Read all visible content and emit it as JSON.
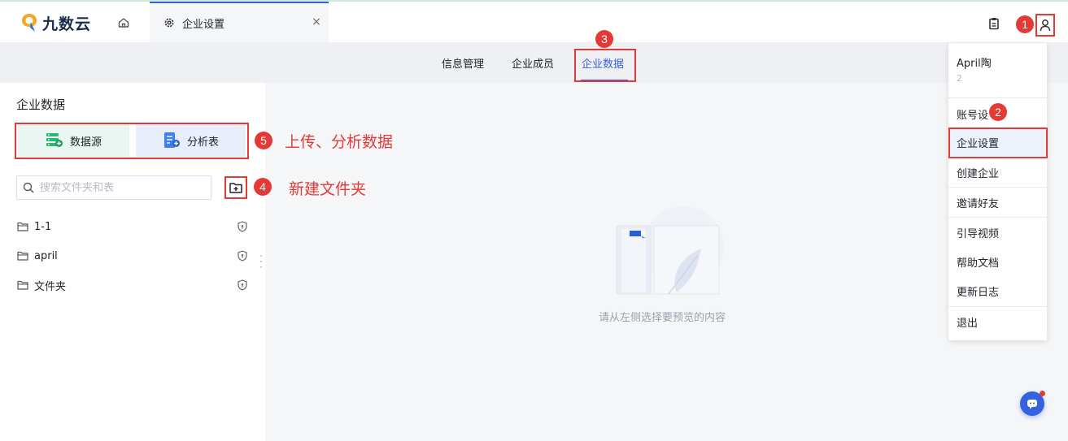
{
  "app": {
    "name": "九数云"
  },
  "tab": {
    "label": "企业设置",
    "close": "×"
  },
  "subnav": {
    "items": [
      "信息管理",
      "企业成员",
      "企业数据"
    ],
    "active": "企业数据"
  },
  "panel": {
    "title": "企业数据",
    "datasource_btn": "数据源",
    "analysis_btn": "分析表",
    "search_placeholder": "搜索文件夹和表",
    "tree": [
      {
        "label": "1-1"
      },
      {
        "label": "april"
      },
      {
        "label": "文件夹"
      }
    ]
  },
  "main": {
    "empty_text": "请从左侧选择要预览的内容"
  },
  "dropdown": {
    "user": "April陶",
    "user_sub": "2",
    "items": [
      "账号设",
      "企业设置",
      "创建企业",
      "邀请好友",
      "引导视频",
      "帮助文档",
      "更新日志",
      "退出"
    ]
  },
  "annotations": {
    "b1": "1",
    "b2": "2",
    "b3": "3",
    "b4": "4",
    "b5": "5",
    "text5": "上传、分析数据",
    "text4": "新建文件夹"
  },
  "colors": {
    "accent": "#3b5fd6",
    "annotation": "#e53935",
    "brand_orange": "#f5a623"
  }
}
